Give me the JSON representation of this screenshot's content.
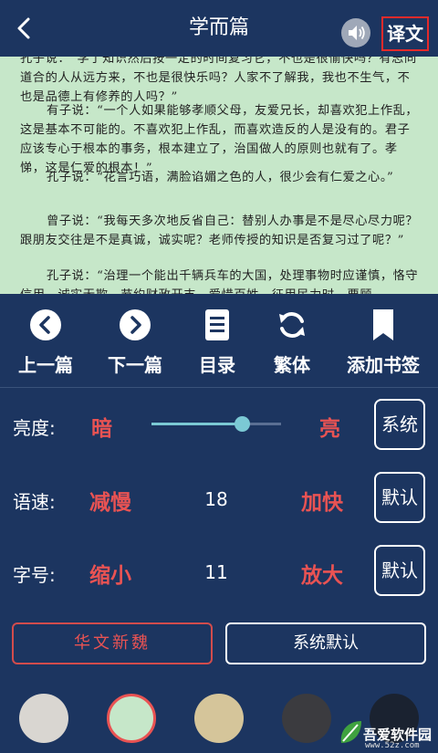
{
  "header": {
    "title": "学而篇",
    "translate_label": "译文",
    "back_icon": "chevron-left-icon",
    "sound_icon": "speaker-icon"
  },
  "reader": {
    "background": "#c6e7c9",
    "paragraphs": [
      "孔子说：“学了知识然后按一定的时间复习它，不也是很愉快吗？有志同道合的人从远方来，不也是很快乐吗？人家不了解我，我也不生气，不也是品德上有修养的人吗？”",
      "有子说：“一个人如果能够孝顺父母，友爱兄长，却喜欢犯上作乱，这是基本不可能的。不喜欢犯上作乱，而喜欢造反的人是没有的。君子应该专心于根本的事务，根本建立了，治国做人的原则也就有了。孝悌，这是仁爱的根本！”",
      "孔子说：“花言巧语，满脸谄媚之色的人，很少会有仁爱之心。”",
      "曾子说：“我每天多次地反省自己：替别人办事是不是尽心尽力呢？跟朋友交往是不是真诚，诚实呢？老师传授的知识是否复习过了呢？”",
      "孔子说：“治理一个能出千辆兵车的大国，处理事物时应谨慎，恪守信用，诚实无欺，节约财政开支，爱惜百姓，征用民力时，要顾"
    ]
  },
  "toolbar": {
    "prev_label": "上一篇",
    "next_label": "下一篇",
    "toc_label": "目录",
    "traditional_label": "繁体",
    "bookmark_label": "添加书签"
  },
  "brightness": {
    "label": "亮度:",
    "dim_label": "暗",
    "bright_label": "亮",
    "button_label": "系统",
    "level": 0.7
  },
  "speed": {
    "label": "语速:",
    "slower_label": "减慢",
    "value": "18",
    "faster_label": "加快",
    "button_label": "默认"
  },
  "font_size": {
    "label": "字号:",
    "smaller_label": "缩小",
    "value": "11",
    "larger_label": "放大",
    "button_label": "默认"
  },
  "fonts": {
    "option_a": "华文新魏",
    "option_b": "系统默认"
  },
  "themes": {
    "colors": [
      "#d9d6d1",
      "#c6e7c9",
      "#d5c59a",
      "#3b3b3f",
      "#1a2230"
    ],
    "selected_index": 1
  },
  "watermark": {
    "text": "吾爱软件园",
    "url": "www.52z.com"
  },
  "colors": {
    "accent_red": "#e95353",
    "navy": "#1c3560"
  }
}
